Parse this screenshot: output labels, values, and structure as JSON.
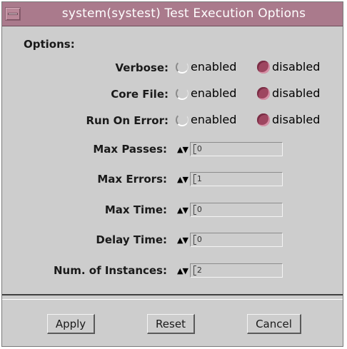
{
  "window": {
    "title": "system(systest) Test Execution Options"
  },
  "options": {
    "heading": "Options:",
    "toggles": [
      {
        "label": "Verbose:",
        "enabled_label": "enabled",
        "disabled_label": "disabled",
        "selected": "disabled"
      },
      {
        "label": "Core File:",
        "enabled_label": "enabled",
        "disabled_label": "disabled",
        "selected": "disabled"
      },
      {
        "label": "Run On Error:",
        "enabled_label": "enabled",
        "disabled_label": "disabled",
        "selected": "disabled"
      }
    ],
    "spinners": [
      {
        "label": "Max Passes:",
        "arrows": "▲▼",
        "value": "0"
      },
      {
        "label": "Max Errors:",
        "arrows": "▲▼",
        "value": "1"
      },
      {
        "label": "Max Time:",
        "arrows": "▲▼",
        "value": "0"
      },
      {
        "label": "Delay Time:",
        "arrows": "▲▼",
        "value": "0"
      },
      {
        "label": "Num. of Instances:",
        "arrows": "▲▼",
        "value": "2"
      }
    ]
  },
  "buttons": {
    "apply": "Apply",
    "reset": "Reset",
    "cancel": "Cancel"
  },
  "colors": {
    "titlebar": "#aa7a8c",
    "window_bg": "#cdcdcd",
    "radio_selected": "#9e4660"
  }
}
